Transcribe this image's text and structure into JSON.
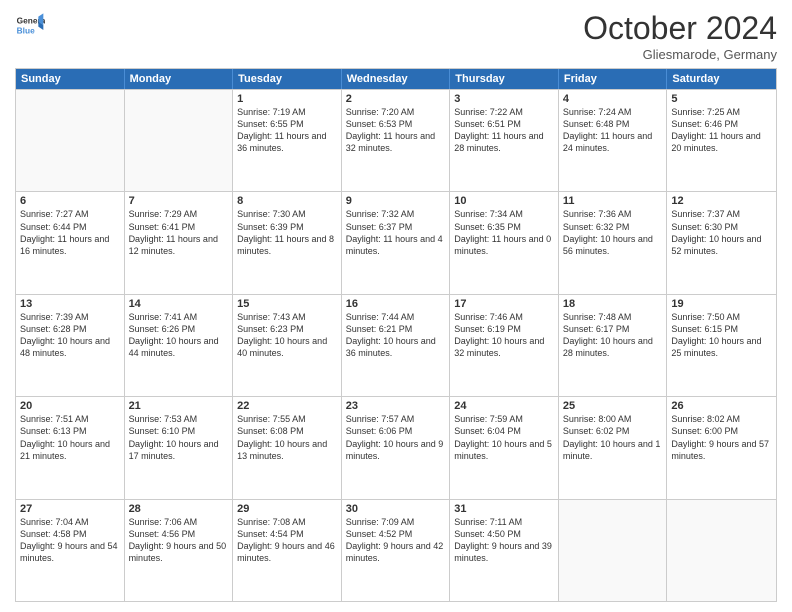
{
  "logo": {
    "line1": "General",
    "line2": "Blue"
  },
  "title": "October 2024",
  "location": "Gliesmarode, Germany",
  "days_of_week": [
    "Sunday",
    "Monday",
    "Tuesday",
    "Wednesday",
    "Thursday",
    "Friday",
    "Saturday"
  ],
  "weeks": [
    [
      {
        "day": "",
        "empty": true
      },
      {
        "day": "",
        "empty": true
      },
      {
        "day": "1",
        "sunrise": "Sunrise: 7:19 AM",
        "sunset": "Sunset: 6:55 PM",
        "daylight": "Daylight: 11 hours and 36 minutes."
      },
      {
        "day": "2",
        "sunrise": "Sunrise: 7:20 AM",
        "sunset": "Sunset: 6:53 PM",
        "daylight": "Daylight: 11 hours and 32 minutes."
      },
      {
        "day": "3",
        "sunrise": "Sunrise: 7:22 AM",
        "sunset": "Sunset: 6:51 PM",
        "daylight": "Daylight: 11 hours and 28 minutes."
      },
      {
        "day": "4",
        "sunrise": "Sunrise: 7:24 AM",
        "sunset": "Sunset: 6:48 PM",
        "daylight": "Daylight: 11 hours and 24 minutes."
      },
      {
        "day": "5",
        "sunrise": "Sunrise: 7:25 AM",
        "sunset": "Sunset: 6:46 PM",
        "daylight": "Daylight: 11 hours and 20 minutes."
      }
    ],
    [
      {
        "day": "6",
        "sunrise": "Sunrise: 7:27 AM",
        "sunset": "Sunset: 6:44 PM",
        "daylight": "Daylight: 11 hours and 16 minutes."
      },
      {
        "day": "7",
        "sunrise": "Sunrise: 7:29 AM",
        "sunset": "Sunset: 6:41 PM",
        "daylight": "Daylight: 11 hours and 12 minutes."
      },
      {
        "day": "8",
        "sunrise": "Sunrise: 7:30 AM",
        "sunset": "Sunset: 6:39 PM",
        "daylight": "Daylight: 11 hours and 8 minutes."
      },
      {
        "day": "9",
        "sunrise": "Sunrise: 7:32 AM",
        "sunset": "Sunset: 6:37 PM",
        "daylight": "Daylight: 11 hours and 4 minutes."
      },
      {
        "day": "10",
        "sunrise": "Sunrise: 7:34 AM",
        "sunset": "Sunset: 6:35 PM",
        "daylight": "Daylight: 11 hours and 0 minutes."
      },
      {
        "day": "11",
        "sunrise": "Sunrise: 7:36 AM",
        "sunset": "Sunset: 6:32 PM",
        "daylight": "Daylight: 10 hours and 56 minutes."
      },
      {
        "day": "12",
        "sunrise": "Sunrise: 7:37 AM",
        "sunset": "Sunset: 6:30 PM",
        "daylight": "Daylight: 10 hours and 52 minutes."
      }
    ],
    [
      {
        "day": "13",
        "sunrise": "Sunrise: 7:39 AM",
        "sunset": "Sunset: 6:28 PM",
        "daylight": "Daylight: 10 hours and 48 minutes."
      },
      {
        "day": "14",
        "sunrise": "Sunrise: 7:41 AM",
        "sunset": "Sunset: 6:26 PM",
        "daylight": "Daylight: 10 hours and 44 minutes."
      },
      {
        "day": "15",
        "sunrise": "Sunrise: 7:43 AM",
        "sunset": "Sunset: 6:23 PM",
        "daylight": "Daylight: 10 hours and 40 minutes."
      },
      {
        "day": "16",
        "sunrise": "Sunrise: 7:44 AM",
        "sunset": "Sunset: 6:21 PM",
        "daylight": "Daylight: 10 hours and 36 minutes."
      },
      {
        "day": "17",
        "sunrise": "Sunrise: 7:46 AM",
        "sunset": "Sunset: 6:19 PM",
        "daylight": "Daylight: 10 hours and 32 minutes."
      },
      {
        "day": "18",
        "sunrise": "Sunrise: 7:48 AM",
        "sunset": "Sunset: 6:17 PM",
        "daylight": "Daylight: 10 hours and 28 minutes."
      },
      {
        "day": "19",
        "sunrise": "Sunrise: 7:50 AM",
        "sunset": "Sunset: 6:15 PM",
        "daylight": "Daylight: 10 hours and 25 minutes."
      }
    ],
    [
      {
        "day": "20",
        "sunrise": "Sunrise: 7:51 AM",
        "sunset": "Sunset: 6:13 PM",
        "daylight": "Daylight: 10 hours and 21 minutes."
      },
      {
        "day": "21",
        "sunrise": "Sunrise: 7:53 AM",
        "sunset": "Sunset: 6:10 PM",
        "daylight": "Daylight: 10 hours and 17 minutes."
      },
      {
        "day": "22",
        "sunrise": "Sunrise: 7:55 AM",
        "sunset": "Sunset: 6:08 PM",
        "daylight": "Daylight: 10 hours and 13 minutes."
      },
      {
        "day": "23",
        "sunrise": "Sunrise: 7:57 AM",
        "sunset": "Sunset: 6:06 PM",
        "daylight": "Daylight: 10 hours and 9 minutes."
      },
      {
        "day": "24",
        "sunrise": "Sunrise: 7:59 AM",
        "sunset": "Sunset: 6:04 PM",
        "daylight": "Daylight: 10 hours and 5 minutes."
      },
      {
        "day": "25",
        "sunrise": "Sunrise: 8:00 AM",
        "sunset": "Sunset: 6:02 PM",
        "daylight": "Daylight: 10 hours and 1 minute."
      },
      {
        "day": "26",
        "sunrise": "Sunrise: 8:02 AM",
        "sunset": "Sunset: 6:00 PM",
        "daylight": "Daylight: 9 hours and 57 minutes."
      }
    ],
    [
      {
        "day": "27",
        "sunrise": "Sunrise: 7:04 AM",
        "sunset": "Sunset: 4:58 PM",
        "daylight": "Daylight: 9 hours and 54 minutes."
      },
      {
        "day": "28",
        "sunrise": "Sunrise: 7:06 AM",
        "sunset": "Sunset: 4:56 PM",
        "daylight": "Daylight: 9 hours and 50 minutes."
      },
      {
        "day": "29",
        "sunrise": "Sunrise: 7:08 AM",
        "sunset": "Sunset: 4:54 PM",
        "daylight": "Daylight: 9 hours and 46 minutes."
      },
      {
        "day": "30",
        "sunrise": "Sunrise: 7:09 AM",
        "sunset": "Sunset: 4:52 PM",
        "daylight": "Daylight: 9 hours and 42 minutes."
      },
      {
        "day": "31",
        "sunrise": "Sunrise: 7:11 AM",
        "sunset": "Sunset: 4:50 PM",
        "daylight": "Daylight: 9 hours and 39 minutes."
      },
      {
        "day": "",
        "empty": true
      },
      {
        "day": "",
        "empty": true
      }
    ]
  ]
}
